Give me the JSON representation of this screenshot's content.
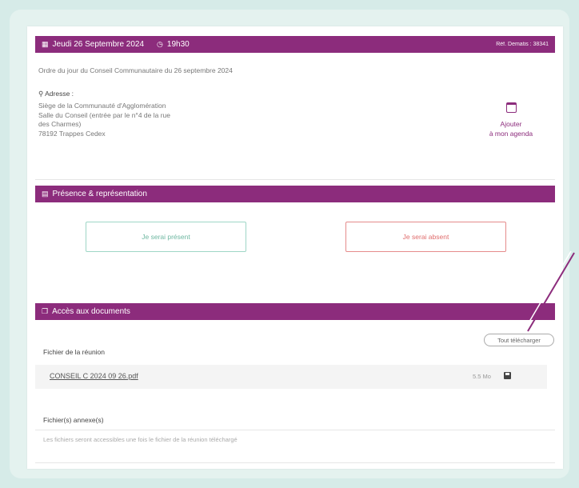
{
  "meeting": {
    "date": "Jeudi 26 Septembre 2024",
    "time": "19h30",
    "ref": "Réf. Dematis : 38341",
    "description": "Ordre du jour du Conseil Communautaire du 26 septembre 2024",
    "address_label": "Adresse :",
    "address_lines": [
      "Siège de la Communauté d'Agglomération",
      "Salle du Conseil (entrée par le n°4 de la rue",
      "des Charmes)",
      "78192 Trappes Cedex"
    ],
    "agenda_line1": "Ajouter",
    "agenda_line2": "à mon agenda"
  },
  "presence": {
    "title": "Présence & représentation",
    "present_label": "Je serai présent",
    "absent_label": "Je serai absent"
  },
  "documents": {
    "title": "Accès aux documents",
    "download_all": "Tout télécharger",
    "meeting_file_label": "Fichier de la réunion",
    "file_name": "CONSEIL C 2024 09 26.pdf",
    "file_size": "5.5 Mo",
    "annexes_label": "Fichier(s) annexe(s)",
    "annexes_note": "Les fichiers seront accessibles une fois le fichier de la réunion téléchargé"
  },
  "colors": {
    "accent": "#8c2c7c",
    "present": "#6fb8a2",
    "absent": "#e06d6d",
    "frame": "#d6ebe8"
  }
}
